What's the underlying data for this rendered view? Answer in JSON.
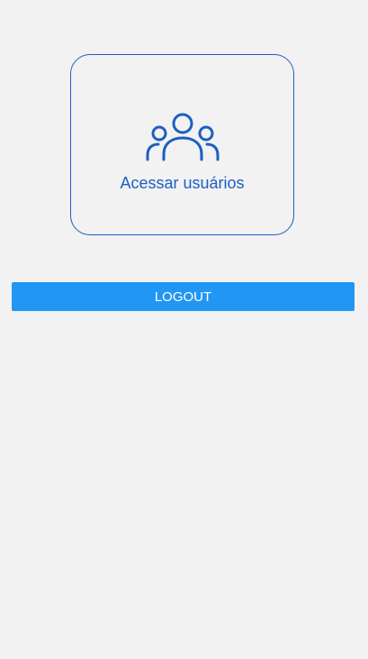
{
  "colors": {
    "background": "#f2f2f2",
    "card_accent": "#1b5fc4",
    "logout_button": "#2196f3",
    "logout_text": "#ffffff"
  },
  "users_card": {
    "icon": "users-group-icon",
    "label": "Acessar usuários"
  },
  "logout": {
    "label": "LOGOUT"
  }
}
